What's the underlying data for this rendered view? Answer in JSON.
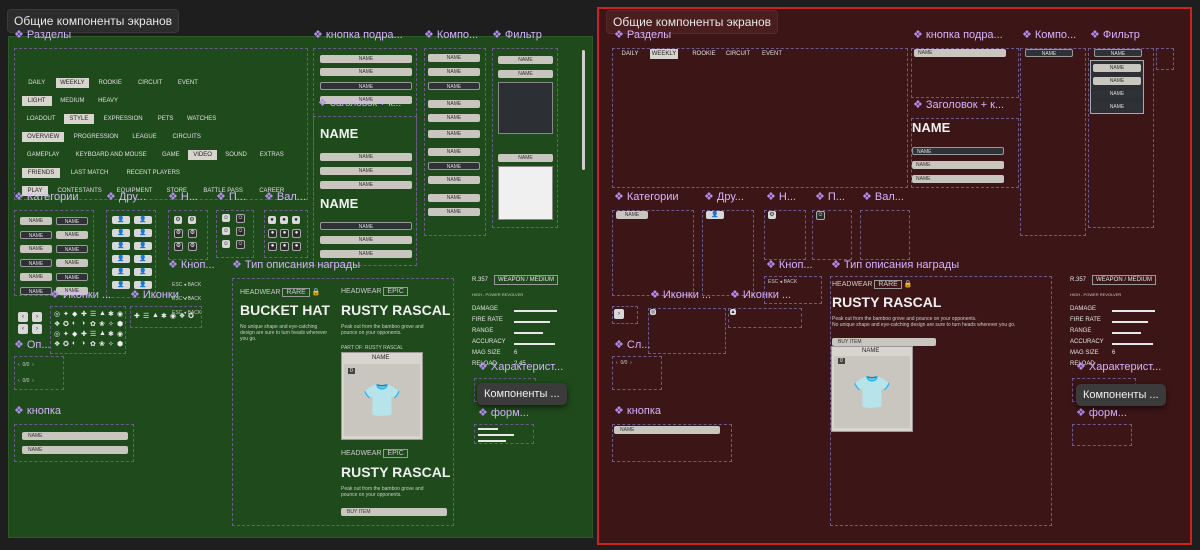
{
  "left_frame": {
    "title": "Общие компоненты экранов",
    "bg": "#1f4a1c",
    "sections": {
      "razdely": "Разделы",
      "knopka_podr": "кнопка подра...",
      "komp": "Компо...",
      "filtr": "Фильтр",
      "kategorii": "Категории",
      "dru": "Дру...",
      "n": "Н...",
      "p": "П...",
      "val": "Вал...",
      "knop": "Кноп...",
      "tip": "Тип описания награды",
      "ikonki1": "Иконки ...",
      "ikonki2": "Иконки ...",
      "op": "Оп...",
      "knopka": "кнопка",
      "zagolovok": "Заголовок + к...",
      "harakterist": "Характерист...",
      "form": "форм..."
    },
    "tabs_rows": [
      [
        "DAILY",
        "WEEKLY",
        "ROOKIE",
        "CIRCUIT",
        "EVENT"
      ],
      [
        "LIGHT",
        "MEDIUM",
        "HEAVY"
      ],
      [
        "LOADOUT",
        "STYLE",
        "EXPRESSION",
        "PETS",
        "WATCHES"
      ],
      [
        "OVERVIEW",
        "PROGRESSION",
        "LEAGUE",
        "CIRCUITS"
      ],
      [
        "GAMEPLAY",
        "KEYBOARD AND MOUSE",
        "GAME",
        "VIDEO",
        "SOUND",
        "EXTRAS"
      ],
      [
        "FRIENDS",
        "LAST MATCH",
        "RECENT PLAYERS"
      ],
      [
        "PLAY",
        "CONTESTANTS",
        "EQUIPMENT",
        "STORE",
        "BATTLE PASS",
        "CAREER"
      ]
    ],
    "name_label": "NAME",
    "esc": "ESC",
    "back": "BACK",
    "zero": "0/0"
  },
  "reward": {
    "headwear": "HEADWEAR",
    "rare": "RARE",
    "epic": "EPIC",
    "bucket_hat": "BUCKET HAT",
    "rusty_rascal": "RUSTY RASCAL",
    "desc1": "No unique shape and eye-catching design are sure to turn heads wherever you go.",
    "desc2": "Peak out from the bamboo grove and pounce on your opponents.",
    "part_of": "PART OF: RUSTY RASCAL",
    "name": "NAME",
    "buy": "BUY ITEM",
    "badge_zero": "0"
  },
  "weapon": {
    "id": "R.357",
    "type": "WEAPON / MEDIUM",
    "sub": "HIGH - POWER REVOLVER",
    "stats": [
      "DAMAGE",
      "FIRE RATE",
      "RANGE",
      "ACCURACY",
      "MAG SIZE",
      "RELOAD"
    ],
    "mag_value": "6",
    "reload_value": "2.45"
  },
  "tooltip_label": "Компоненты ...",
  "right_frame": {
    "title": "Общие компоненты экранов",
    "bg": "#3c1517",
    "border": "#cc2222",
    "sections": {
      "razdely": "Разделы",
      "knopka_podr": "кнопка подра...",
      "komp": "Компо...",
      "filtr": "Фильтр",
      "zagolovok": "Заголовок + к...",
      "kategorii": "Категории",
      "dru": "Дру...",
      "n": "Н...",
      "p": "П...",
      "val": "Вал...",
      "knop": "Кноп...",
      "tip": "Тип описания награды",
      "ikonki1": "Иконки ...",
      "ikonki2": "Иконки ...",
      "sl": "Сл...",
      "knopka": "кнопка",
      "harakterist": "Характерист...",
      "form": "форм..."
    },
    "tabs": [
      "DAILY",
      "WEEKLY",
      "ROOKIE",
      "CIRCUIT",
      "EVENT"
    ],
    "name_label": "NAME",
    "big_name": "NAME"
  }
}
